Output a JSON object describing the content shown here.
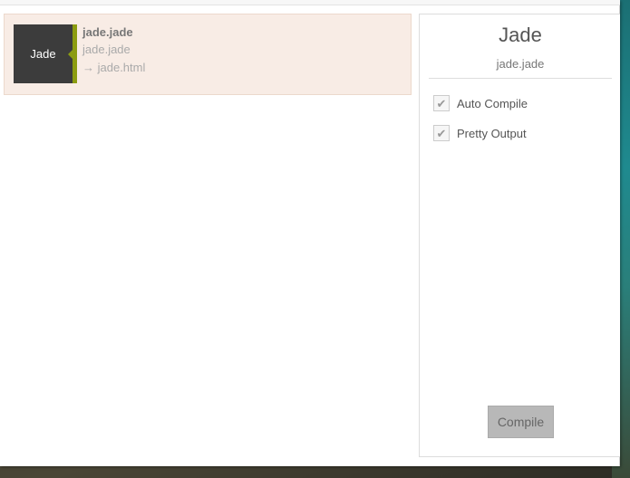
{
  "file_list": {
    "items": [
      {
        "badge": "Jade",
        "name": "jade.jade",
        "source": "jade.jade",
        "output": "→ jade.html",
        "badge_color": "#3c3c3c",
        "accent_color": "#8c9c10"
      }
    ]
  },
  "settings_panel": {
    "title": "Jade",
    "subtitle": "jade.jade",
    "options": [
      {
        "label": "Auto Compile",
        "checked": true
      },
      {
        "label": "Pretty Output",
        "checked": true
      }
    ],
    "check_glyph": "✔",
    "compile_label": "Compile"
  },
  "colors": {
    "selected_row_bg": "#f8ece5",
    "button_bg": "#b8b8b8"
  }
}
